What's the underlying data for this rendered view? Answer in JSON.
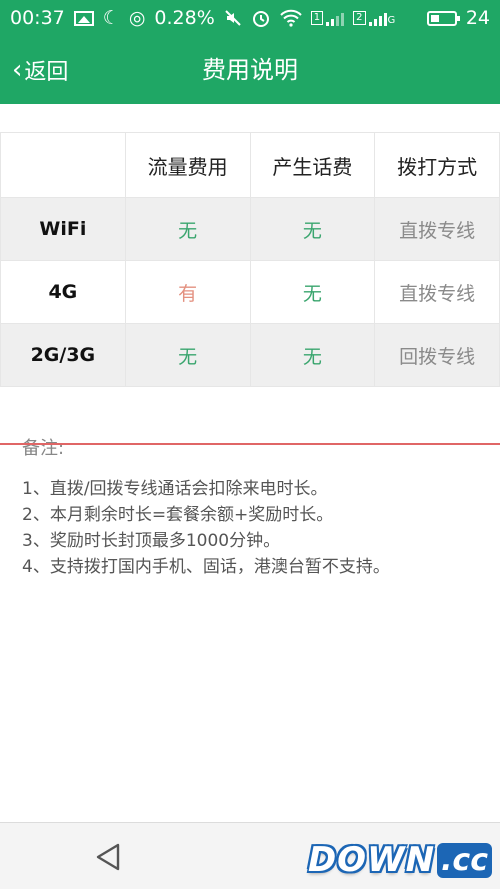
{
  "status_bar": {
    "time": "00:37",
    "data_rate": "0.28%",
    "battery_level": "24",
    "sim1": "1",
    "sim2": "2",
    "network_type": "G"
  },
  "header": {
    "back_label": "返回",
    "title": "费用说明"
  },
  "table": {
    "columns": [
      "",
      "流量费用",
      "产生话费",
      "拨打方式"
    ],
    "rows": [
      {
        "name": "WiFi",
        "data_fee": "无",
        "call_fee": "无",
        "dial_method": "直拨专线"
      },
      {
        "name": "4G",
        "data_fee": "有",
        "call_fee": "无",
        "dial_method": "直拨专线"
      },
      {
        "name": "2G/3G",
        "data_fee": "无",
        "call_fee": "无",
        "dial_method": "回拨专线"
      }
    ]
  },
  "notes": {
    "title": "备注:",
    "items": [
      "1、直拨/回拨专线通话会扣除来电时长。",
      "2、本月剩余时长=套餐余额+奖励时长。",
      "3、奖励时长封顶最多1000分钟。",
      "4、支持拨打国内手机、固话，港澳台暂不支持。"
    ]
  },
  "watermark": {
    "text": "DOWN",
    "tld": ".cc"
  },
  "colors": {
    "brand_green": "#1fa765",
    "value_green": "#3aa56e",
    "value_red": "#e39180",
    "divider_red": "#e06666"
  }
}
